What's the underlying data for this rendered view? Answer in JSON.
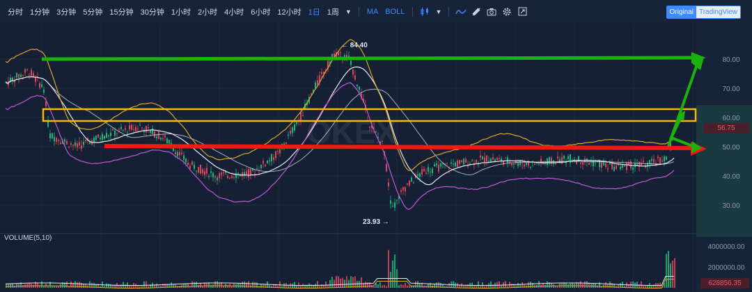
{
  "toolbar": {
    "timeframes": [
      "分时",
      "1分钟",
      "3分钟",
      "5分钟",
      "15分钟",
      "30分钟",
      "1小时",
      "2小时",
      "4小时",
      "6小时",
      "12小时",
      "1日",
      "1周"
    ],
    "active_timeframe": "1日",
    "indicators": [
      "MA",
      "BOLL"
    ],
    "icons": [
      "candlestick-type-icon",
      "indicator-icon",
      "drawing-tools-icon",
      "camera-icon",
      "settings-gear-icon",
      "fullscreen-icon"
    ],
    "view_toggle": {
      "original": "Original",
      "tradingview": "TradingView"
    }
  },
  "chart": {
    "watermark": "OKEX",
    "high_annotation": "84.40",
    "low_annotation": "23.93",
    "current_price": "56.75",
    "price_axis_ticks": [
      "80.00",
      "70.00",
      "60.00",
      "50.00",
      "40.00",
      "30.00"
    ],
    "volume_label": "VOLUME(5,10)",
    "volume_axis_ticks": [
      "4000000.00",
      "2000000.00"
    ],
    "current_volume": "628856.35",
    "colors": {
      "background": "#152034",
      "up_candle": "#1fb57a",
      "down_candle": "#e0465a",
      "ma_white": "#e8edf5",
      "boll_upper_lower_magenta": "#c259d6",
      "boll_band_gold": "#d9a92b",
      "resistance_line_green": "#1bb30b",
      "support_line_red": "#f01a12",
      "zone_box_yellow": "#f7b80c"
    }
  },
  "chart_data": {
    "type": "candlestick",
    "ylim": [
      20,
      90
    ],
    "y_ticks": [
      30,
      40,
      50,
      60,
      70,
      80
    ],
    "annotations": [
      {
        "label": "84.40",
        "kind": "high"
      },
      {
        "label": "23.93",
        "kind": "low"
      }
    ],
    "current_price": 56.75,
    "horizontal_lines": [
      {
        "color": "green",
        "value": 80
      },
      {
        "color": "red",
        "value": 50
      }
    ],
    "zone": {
      "color": "yellow",
      "from": 58,
      "to": 62
    },
    "volume": {
      "label": "VOLUME(5,10)",
      "ylim": [
        0,
        4000000
      ],
      "y_ticks": [
        2000000,
        4000000
      ],
      "current": 628856.35
    }
  }
}
